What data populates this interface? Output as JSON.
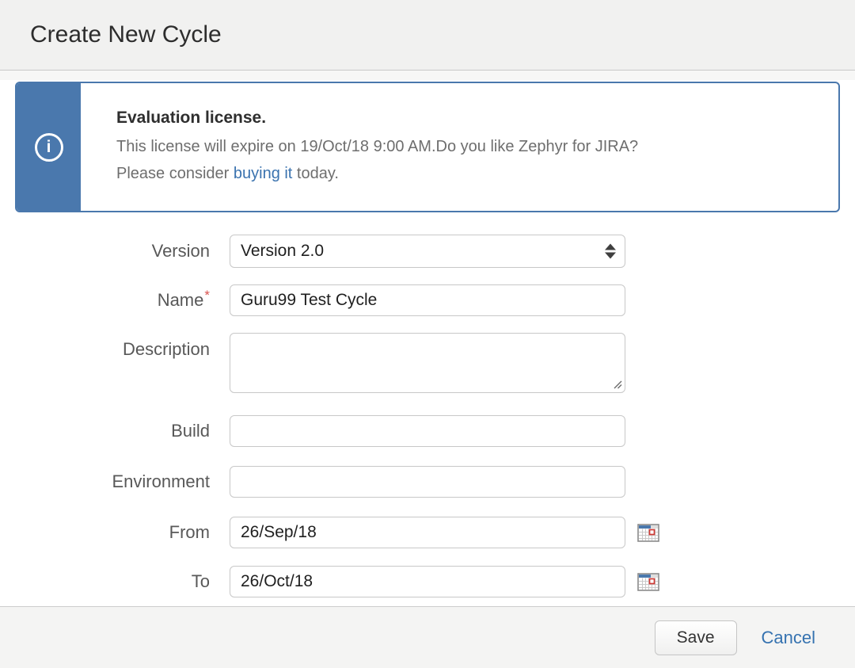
{
  "dialog": {
    "title": "Create New Cycle"
  },
  "banner": {
    "icon_glyph": "i",
    "title": "Evaluation license.",
    "message_line1": "This license will expire on 19/Oct/18 9:00 AM.Do you like Zephyr for JIRA?",
    "message_line2_prefix": "Please consider ",
    "message_link": "buying it",
    "message_line2_suffix": " today."
  },
  "form": {
    "version": {
      "label": "Version",
      "value": "Version 2.0"
    },
    "name": {
      "label": "Name",
      "required_marker": "*",
      "value": "Guru99 Test Cycle"
    },
    "description": {
      "label": "Description",
      "value": ""
    },
    "build": {
      "label": "Build",
      "value": ""
    },
    "environment": {
      "label": "Environment",
      "value": ""
    },
    "from": {
      "label": "From",
      "value": "26/Sep/18"
    },
    "to": {
      "label": "To",
      "value": "26/Oct/18"
    }
  },
  "footer": {
    "save": "Save",
    "cancel": "Cancel"
  },
  "colors": {
    "banner_blue": "#4a78ad",
    "link_blue": "#3b73af",
    "required_red": "#d9534f",
    "header_gray": "#f1f1f0",
    "footer_gray": "#f4f4f3"
  }
}
